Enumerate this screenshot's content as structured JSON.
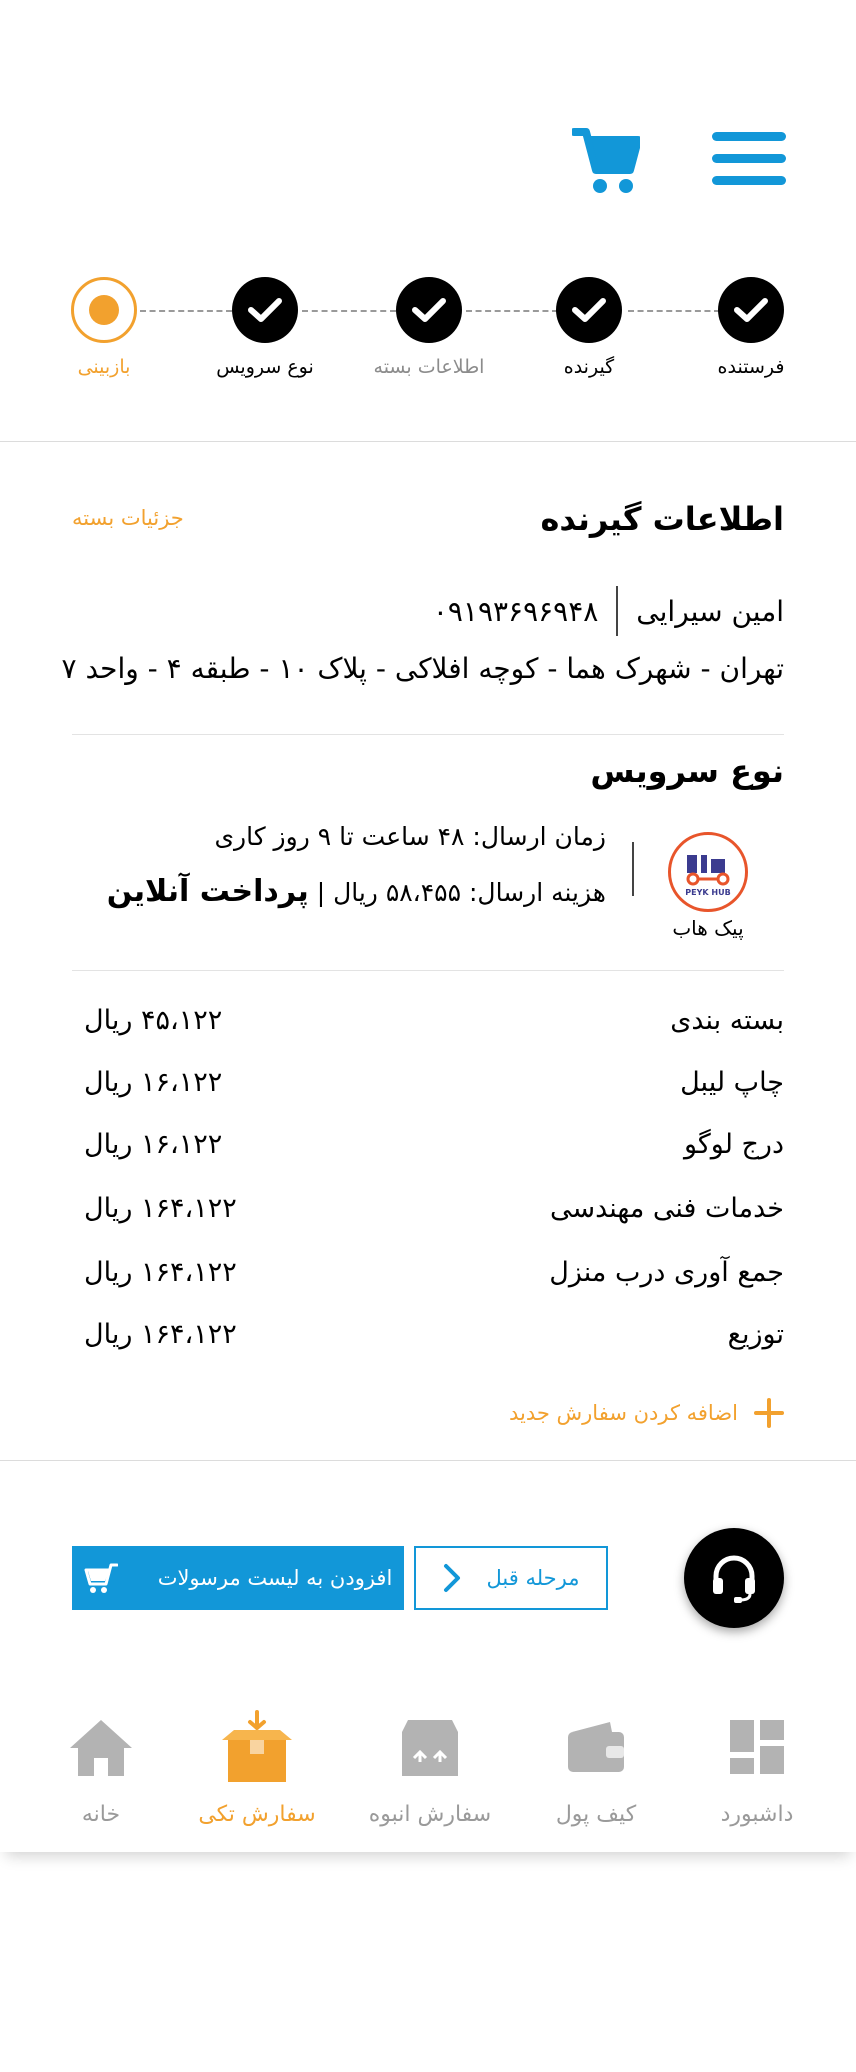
{
  "header": {
    "menu_icon": "hamburger-menu-icon",
    "cart_icon": "shopping-cart-icon",
    "accent_color": "#1297d8"
  },
  "stepper": {
    "steps": [
      {
        "label": "فرستنده",
        "state": "done"
      },
      {
        "label": "گیرنده",
        "state": "done"
      },
      {
        "label": "اطلاعات بسته",
        "state": "done"
      },
      {
        "label": "نوع سرویس",
        "state": "done"
      },
      {
        "label": "بازبینی",
        "state": "current"
      }
    ],
    "current_color": "#f2a12e"
  },
  "recipient": {
    "title": "اطلاعات گیرنده",
    "details_link": "جزئیات بسته",
    "name": "امین سیرایی",
    "phone": "۰۹۱۹۳۶۹۶۹۴۸",
    "address": "تهران - شهرک هما - کوچه افلاکی - پلاک ۱۰ - طبقه ۴ - واحد ۷"
  },
  "service": {
    "title": "نوع سرویس",
    "logo_text": "PEYK HUB",
    "logo_name": "پیک هاب",
    "send_time": "زمان ارسال: ۴۸ ساعت تا ۹ روز کاری",
    "cost_prefix": "هزینه ارسال: ۵۸،۴۵۵ ریال | ",
    "payment": "پرداخت آنلاین"
  },
  "fees": [
    {
      "label": "بسته بندی",
      "amount": "۴۵،۱۲۲ ریال"
    },
    {
      "label": "چاپ لیبل",
      "amount": "۱۶،۱۲۲ ریال"
    },
    {
      "label": "درج لوگو",
      "amount": "۱۶،۱۲۲ ریال"
    },
    {
      "label": "خدمات فنی مهندسی",
      "amount": "۱۶۴،۱۲۲ ریال"
    },
    {
      "label": "جمع آوری درب منزل",
      "amount": "۱۶۴،۱۲۲ ریال"
    },
    {
      "label": "توزیع",
      "amount": "۱۶۴،۱۲۲ ریال"
    }
  ],
  "actions": {
    "add_new_order": "اضافه کردن سفارش جدید",
    "prev_step": "مرحله قبل",
    "add_to_list": "افزودن به لیست مرسولات",
    "support_icon": "headset-icon"
  },
  "bottom_nav": {
    "items": [
      {
        "label": "داشبورد",
        "icon": "dashboard-icon",
        "active": false
      },
      {
        "label": "کیف پول",
        "icon": "wallet-icon",
        "active": false
      },
      {
        "label": "سفارش انبوه",
        "icon": "bulk-box-icon",
        "active": false
      },
      {
        "label": "سفارش تکی",
        "icon": "single-box-icon",
        "active": true
      },
      {
        "label": "خانه",
        "icon": "home-icon",
        "active": false
      }
    ],
    "active_color": "#f2a12e",
    "inactive_color": "#b3b3b3"
  }
}
